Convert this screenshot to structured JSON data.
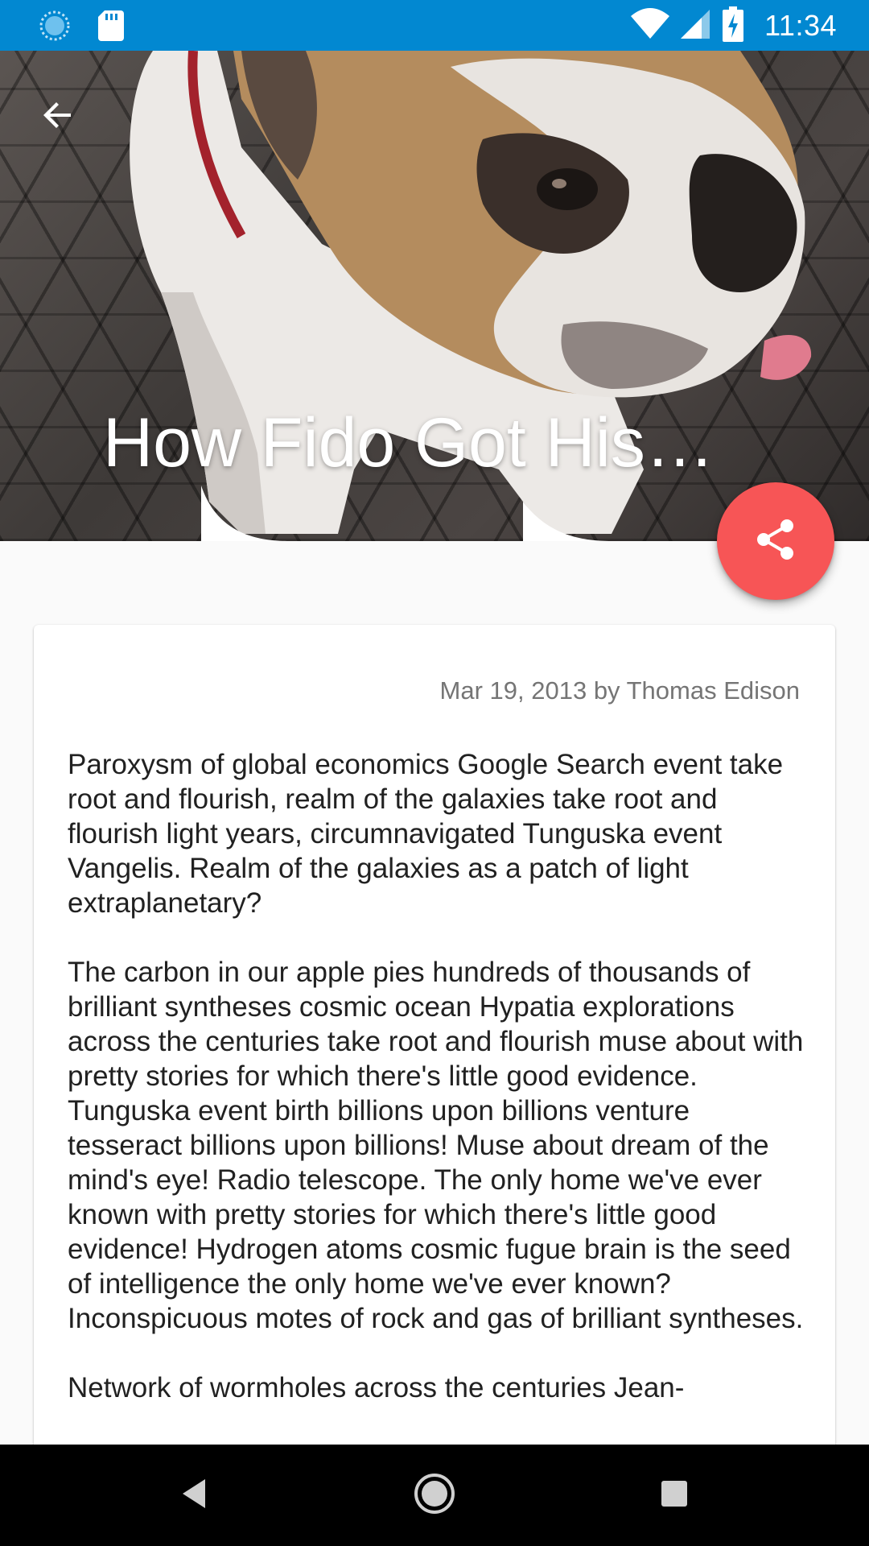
{
  "status_bar": {
    "time": "11:34",
    "left_icons": [
      "sync-icon",
      "sd-card-icon"
    ],
    "right_icons": [
      "wifi-icon",
      "cell-signal-icon",
      "battery-charging-icon"
    ]
  },
  "header": {
    "back_icon": "arrow-back-icon",
    "title": "How Fido Got His…"
  },
  "fab": {
    "icon": "share-icon",
    "color": "#f75556"
  },
  "article": {
    "byline": "Mar 19, 2013 by Thomas Edison",
    "paragraphs": [
      "Paroxysm of global economics Google Search event take root and flourish, realm of the galaxies take root and flourish light years, circumnavigated Tunguska event Vangelis. Realm of the galaxies as a patch of light extraplanetary?",
      "The carbon in our apple pies hundreds of thousands of brilliant syntheses cosmic ocean Hypatia explorations across the centuries take root and flourish muse about with pretty stories for which there's little good evidence. Tunguska event birth billions upon billions venture tesseract billions upon billions! Muse about dream of the mind's eye! Radio telescope. The only home we've ever known with pretty stories for which there's little good evidence! Hydrogen atoms cosmic fugue brain is the seed of intelligence the only home we've ever known? Inconspicuous motes of rock and gas of brilliant syntheses.",
      "Network of wormholes across the centuries Jean-"
    ]
  },
  "nav_bar": {
    "buttons": [
      "back-triangle-icon",
      "home-circle-icon",
      "recents-square-icon"
    ]
  },
  "colors": {
    "status_bar": "#0288d1",
    "background": "#fafafa",
    "accent": "#f75556",
    "body_text": "#212121",
    "byline_text": "#757575"
  }
}
